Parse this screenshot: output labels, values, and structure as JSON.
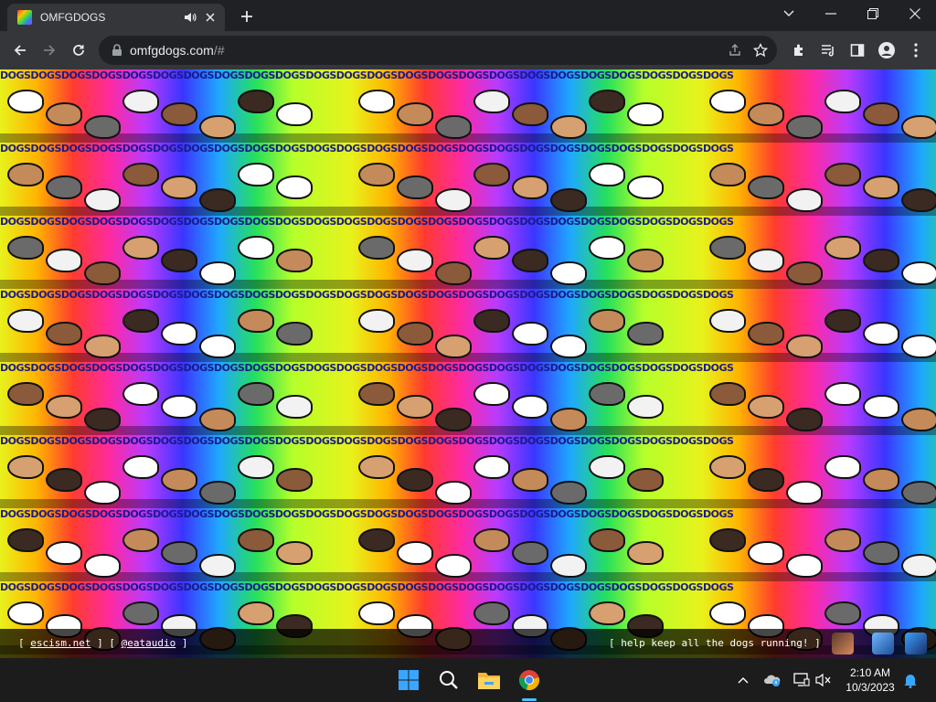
{
  "browser": {
    "tab": {
      "title": "OMFGDOGS",
      "favicon": "omfgdogs-favicon",
      "audio_icon": "speaker-icon",
      "close_icon": "close-icon"
    },
    "new_tab_icon": "plus-icon",
    "window_controls": [
      "chevron-down-icon",
      "minimize-icon",
      "restore-icon",
      "close-icon"
    ],
    "url_host": "omfgdogs.com",
    "url_path": "/#",
    "nav_icons": [
      "back-arrow-icon",
      "forward-arrow-icon",
      "reload-icon"
    ],
    "omnibox_icons": [
      "share-icon",
      "star-icon"
    ],
    "toolbar_icons": [
      "puzzle-icon",
      "media-queue-icon",
      "side-panel-icon",
      "profile-icon",
      "more-vertical-icon"
    ]
  },
  "page": {
    "banner_word": "DOGSDOGSDOGSDOGSDOGSDOGSDOGSDOGSDOGSDOGSDOGSDOGSDOGSDOGSDOGSDOGSDOGSDOGSDOGSDOGSDOGSDOGSDOGSDOGS",
    "footer": {
      "left_bracket_open": "[",
      "link1": "escism.net",
      "mid": "] [",
      "link2": "@eataudio",
      "left_bracket_close": "]",
      "right_text": "[ help keep all the dogs running! ]"
    }
  },
  "taskbar": {
    "icons": [
      "windows-start-icon",
      "search-icon",
      "file-explorer-icon",
      "chrome-icon"
    ],
    "tray_icons": [
      "chevron-up-icon",
      "onedrive-icon",
      "display-icon",
      "muted-speaker-icon",
      "notification-bell-icon"
    ],
    "time": "2:10 AM",
    "date": "10/3/2023"
  },
  "colors": {
    "tabstrip": "#202124",
    "toolbar": "#35363a",
    "omnibox": "#202124",
    "text": "#e8eaed",
    "taskbar": "#1c1c1c",
    "accent": "#4cc2ff"
  }
}
